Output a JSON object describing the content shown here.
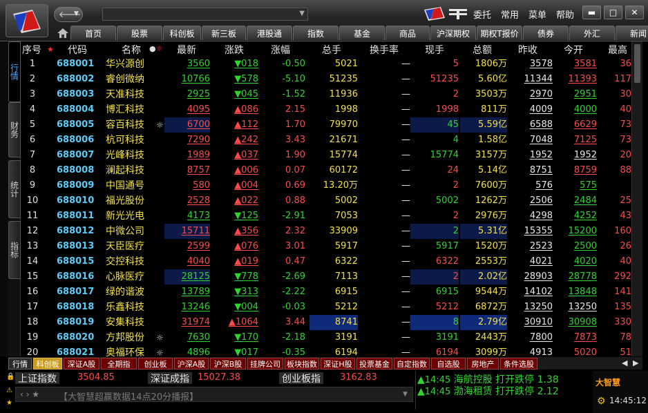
{
  "window": {
    "menus": [
      "委托",
      "常用",
      "菜单",
      "帮助"
    ],
    "controls": [
      "▬",
      "□",
      "✕"
    ],
    "search_value": ""
  },
  "tabs": [
    "首页",
    "股票",
    "科创板",
    "新三板",
    "港股通",
    "指数",
    "基金",
    "商品",
    "沪深期权",
    "期权T报价",
    "债券",
    "外汇",
    "新闻"
  ],
  "side_tabs": [
    "行情",
    "财务",
    "统计",
    "指标"
  ],
  "table": {
    "headers": [
      "序号",
      "代码",
      "名称",
      "最新",
      "涨跌",
      "涨幅",
      "总手",
      "换手率",
      "现手",
      "总额",
      "昨收",
      "今开",
      "最高"
    ],
    "rows": [
      {
        "idx": "1",
        "code": "688001",
        "name": "华兴源创",
        "mark": "",
        "last": "3560",
        "chg": "▼018",
        "pct": "-0.50",
        "vol": "5021",
        "turn": "—",
        "cur": "5",
        "amt": "1806万",
        "prev": "3578",
        "open": "3581",
        "high": "36",
        "dir": "down",
        "curc": "red",
        "openc": "red",
        "highc": "red",
        "hl": ""
      },
      {
        "idx": "2",
        "code": "688002",
        "name": "睿创微纳",
        "mark": "",
        "last": "10766",
        "chg": "▼578",
        "pct": "-5.10",
        "vol": "51235",
        "turn": "—",
        "cur": "51235",
        "amt": "5.60亿",
        "prev": "11344",
        "open": "11393",
        "high": "117",
        "dir": "down",
        "curc": "red",
        "openc": "red",
        "highc": "red",
        "hl": ""
      },
      {
        "idx": "3",
        "code": "688003",
        "name": "天准科技",
        "mark": "",
        "last": "2925",
        "chg": "▼045",
        "pct": "-1.52",
        "vol": "11936",
        "turn": "—",
        "cur": "2",
        "amt": "3503万",
        "prev": "2970",
        "open": "2951",
        "high": "30",
        "dir": "down",
        "curc": "red",
        "openc": "green",
        "highc": "red",
        "hl": ""
      },
      {
        "idx": "4",
        "code": "688004",
        "name": "博汇科技",
        "mark": "",
        "last": "4095",
        "chg": "▲086",
        "pct": "2.15",
        "vol": "1998",
        "turn": "—",
        "cur": "1998",
        "amt": "811万",
        "prev": "4009",
        "open": "4000",
        "high": "40",
        "dir": "up",
        "curc": "red",
        "openc": "green",
        "highc": "red",
        "hl": ""
      },
      {
        "idx": "5",
        "code": "688005",
        "name": "容百科技",
        "mark": "☼",
        "last": "6700",
        "chg": "▲112",
        "pct": "1.70",
        "vol": "79970",
        "turn": "—",
        "cur": "45",
        "amt": "5.59亿",
        "prev": "6588",
        "open": "6629",
        "high": "73",
        "dir": "up",
        "curc": "green",
        "openc": "red",
        "highc": "red",
        "hl": "hl"
      },
      {
        "idx": "6",
        "code": "688006",
        "name": "杭可科技",
        "mark": "",
        "last": "7290",
        "chg": "▲242",
        "pct": "3.43",
        "vol": "21671",
        "turn": "—",
        "cur": "4",
        "amt": "1.58亿",
        "prev": "7048",
        "open": "7125",
        "high": "73",
        "dir": "up",
        "curc": "green",
        "openc": "red",
        "highc": "red",
        "hl": ""
      },
      {
        "idx": "7",
        "code": "688007",
        "name": "光峰科技",
        "mark": "",
        "last": "1989",
        "chg": "▲037",
        "pct": "1.90",
        "vol": "15774",
        "turn": "—",
        "cur": "15774",
        "amt": "3157万",
        "prev": "1952",
        "open": "1952",
        "high": "20",
        "dir": "up",
        "curc": "green",
        "openc": "white",
        "highc": "red",
        "hl": ""
      },
      {
        "idx": "8",
        "code": "688008",
        "name": "澜起科技",
        "mark": "",
        "last": "8757",
        "chg": "▲006",
        "pct": "0.07",
        "vol": "60172",
        "turn": "—",
        "cur": "24",
        "amt": "5.14亿",
        "prev": "8751",
        "open": "8759",
        "high": "88",
        "dir": "up",
        "curc": "red",
        "openc": "red",
        "highc": "red",
        "hl": ""
      },
      {
        "idx": "9",
        "code": "688009",
        "name": "中国通号",
        "mark": "",
        "last": "580",
        "chg": "▲004",
        "pct": "0.69",
        "vol": "13.20万",
        "turn": "—",
        "cur": "2",
        "amt": "7600万",
        "prev": "576",
        "open": "575",
        "high": "",
        "dir": "up",
        "curc": "red",
        "openc": "green",
        "highc": "red",
        "hl": ""
      },
      {
        "idx": "10",
        "code": "688010",
        "name": "福光股份",
        "mark": "",
        "last": "2528",
        "chg": "▲022",
        "pct": "0.88",
        "vol": "5002",
        "turn": "—",
        "cur": "5002",
        "amt": "1262万",
        "prev": "2506",
        "open": "2484",
        "high": "25",
        "dir": "up",
        "curc": "green",
        "openc": "green",
        "highc": "red",
        "hl": ""
      },
      {
        "idx": "11",
        "code": "688011",
        "name": "新光光电",
        "mark": "",
        "last": "4173",
        "chg": "▼125",
        "pct": "-2.91",
        "vol": "7053",
        "turn": "—",
        "cur": "2",
        "amt": "2976万",
        "prev": "4298",
        "open": "4252",
        "high": "43",
        "dir": "down",
        "curc": "red",
        "openc": "green",
        "highc": "red",
        "hl": ""
      },
      {
        "idx": "12",
        "code": "688012",
        "name": "中微公司",
        "mark": "",
        "last": "15711",
        "chg": "▲356",
        "pct": "2.32",
        "vol": "33909",
        "turn": "—",
        "cur": "2",
        "amt": "5.31亿",
        "prev": "15355",
        "open": "15200",
        "high": "160",
        "dir": "up",
        "curc": "green",
        "openc": "green",
        "highc": "red",
        "hl": "hl"
      },
      {
        "idx": "13",
        "code": "688013",
        "name": "天臣医疗",
        "mark": "",
        "last": "2599",
        "chg": "▲076",
        "pct": "3.01",
        "vol": "5917",
        "turn": "—",
        "cur": "5917",
        "amt": "1520万",
        "prev": "2523",
        "open": "2500",
        "high": "26",
        "dir": "up",
        "curc": "green",
        "openc": "green",
        "highc": "red",
        "hl": ""
      },
      {
        "idx": "14",
        "code": "688015",
        "name": "交控科技",
        "mark": "",
        "last": "4040",
        "chg": "▲019",
        "pct": "0.47",
        "vol": "6322",
        "turn": "—",
        "cur": "6322",
        "amt": "2553万",
        "prev": "4021",
        "open": "4020",
        "high": "40",
        "dir": "up",
        "curc": "red",
        "openc": "green",
        "highc": "red",
        "hl": ""
      },
      {
        "idx": "15",
        "code": "688016",
        "name": "心脉医疗",
        "mark": "",
        "last": "28125",
        "chg": "▼778",
        "pct": "-2.69",
        "vol": "7113",
        "turn": "—",
        "cur": "2",
        "amt": "2.02亿",
        "prev": "28903",
        "open": "28778",
        "high": "292",
        "dir": "down",
        "curc": "red",
        "openc": "green",
        "highc": "red",
        "hl": "hl"
      },
      {
        "idx": "16",
        "code": "688017",
        "name": "绿的谐波",
        "mark": "",
        "last": "13789",
        "chg": "▼313",
        "pct": "-2.22",
        "vol": "6915",
        "turn": "—",
        "cur": "6915",
        "amt": "9544万",
        "prev": "14102",
        "open": "13848",
        "high": "141",
        "dir": "down",
        "curc": "green",
        "openc": "green",
        "highc": "red",
        "hl": ""
      },
      {
        "idx": "17",
        "code": "688018",
        "name": "乐鑫科技",
        "mark": "",
        "last": "13246",
        "chg": "▼004",
        "pct": "-0.03",
        "vol": "5212",
        "turn": "—",
        "cur": "5212",
        "amt": "6872万",
        "prev": "13250",
        "open": "13250",
        "high": "135",
        "dir": "down",
        "curc": "red",
        "openc": "white",
        "highc": "red",
        "hl": ""
      },
      {
        "idx": "18",
        "code": "688019",
        "name": "安集科技",
        "mark": "",
        "last": "31974",
        "chg": "▲1064",
        "pct": "3.44",
        "vol": "8741",
        "turn": "—",
        "cur": "8",
        "amt": "2.79亿",
        "prev": "30910",
        "open": "30908",
        "high": "330",
        "dir": "up",
        "curc": "green",
        "openc": "green",
        "highc": "red",
        "hl": "strong"
      },
      {
        "idx": "19",
        "code": "688020",
        "name": "方邦股份",
        "mark": "☼",
        "last": "7630",
        "chg": "▼170",
        "pct": "-2.18",
        "vol": "3191",
        "turn": "—",
        "cur": "3191",
        "amt": "2443万",
        "prev": "7800",
        "open": "7873",
        "high": "78",
        "dir": "down",
        "curc": "green",
        "openc": "red",
        "highc": "red",
        "hl": ""
      },
      {
        "idx": "20",
        "code": "688021",
        "name": "奥福环保",
        "mark": "☼",
        "last": "4896",
        "chg": "▼017",
        "pct": "-0.35",
        "vol": "6194",
        "turn": "—",
        "cur": "6194",
        "amt": "3099万",
        "prev": "4913",
        "open": "5020",
        "high": "51",
        "dir": "down",
        "curc": "red",
        "openc": "red",
        "highc": "red",
        "hl": ""
      }
    ]
  },
  "categories": [
    "行情",
    "科创板",
    "深证A股",
    "全期指",
    "创业板",
    "沪深A股",
    "沪深B股",
    "挂牌公司",
    "板块指数",
    "深证H股",
    "投票基金",
    "自定指数",
    "自选股",
    "房地产",
    "条件选股"
  ],
  "indices": [
    {
      "label": "上证指数",
      "value": "3504.85"
    },
    {
      "label": "深证成指",
      "value": "15027.38"
    },
    {
      "label": "创业板指",
      "value": "3162.83"
    }
  ],
  "news": "【大智慧超赢数据14点20分播报】",
  "alerts": [
    {
      "time": "14:45",
      "text": "海航控股 打开跌停 1.38"
    },
    {
      "time": "14:45",
      "text": "渤海租赁 打开跌停 2.12"
    }
  ],
  "brand": "大智慧",
  "clock": "14:45:12",
  "colors": {
    "up": "#ff4a4a",
    "down": "#2fd52f",
    "code": "#5ecbf5",
    "name": "#f2e04b"
  }
}
